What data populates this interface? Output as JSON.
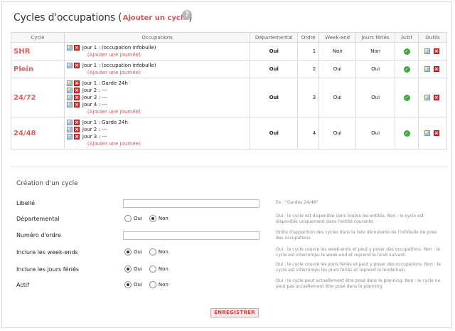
{
  "header": {
    "title": "Cycles d'occupations",
    "open_paren": "(",
    "add_link": "Ajouter un cycle",
    "close_paren": ")",
    "help_icon": "question-circle-icon"
  },
  "table": {
    "columns": [
      "Cycle",
      "Occupations",
      "Départemental",
      "Ordre",
      "Week-end",
      "Jours fériés",
      "Actif",
      "Outils"
    ],
    "add_day_link": "Ajouter une journée",
    "add_day_open": "(",
    "add_day_close": ")",
    "rows": [
      {
        "name": "SHR",
        "occupations": [
          "Jour 1 : (occupation infobulle)"
        ],
        "departemental": "Oui",
        "ordre": "1",
        "weekend": "Non",
        "feries": "Non",
        "actif": "check-icon"
      },
      {
        "name": "Plein",
        "occupations": [
          "Jour 1 : (occupation infobulle)"
        ],
        "departemental": "Oui",
        "ordre": "2",
        "weekend": "Oui",
        "feries": "Oui",
        "actif": "check-icon"
      },
      {
        "name": "24/72",
        "occupations": [
          "Jour 1 : Garde 24h",
          "Jour 2 : ---",
          "Jour 3 : ---",
          "Jour 4 : ---"
        ],
        "departemental": "Oui",
        "ordre": "3",
        "weekend": "Oui",
        "feries": "Oui",
        "actif": "check-icon"
      },
      {
        "name": "24/48",
        "occupations": [
          "Jour 1 : Garde 24h",
          "Jour 2 : ---",
          "Jour 3 : ---"
        ],
        "departemental": "Oui",
        "ordre": "4",
        "weekend": "Oui",
        "feries": "Oui",
        "actif": "check-icon"
      }
    ]
  },
  "form": {
    "title": "Création d'un cycle",
    "libelle": {
      "label": "Libellé",
      "value": "",
      "help": "Ex : \"Gardes 24/48\""
    },
    "departemental": {
      "label": "Départemental",
      "options": [
        "Oui",
        "Non"
      ],
      "selected": "Non",
      "help": "Oui : le cycle est disponible dans toutes les entités.\nNon : le cycle est disponible uniquement dans l'entité courante."
    },
    "ordre": {
      "label": "Numéro d'ordre",
      "value": "",
      "help": "Ordre d'apparition des cycles dans la liste déroulante de l'infobulle de pose des occupations"
    },
    "weekends": {
      "label": "Inclure les week-ends",
      "options": [
        "Oui",
        "Non"
      ],
      "selected": "Oui",
      "help": "Oui : le cycle couvre les week-ends et peut y poser des occupations.\nNon : le cycle est interrompu le week-end et reprend le lundi suivant."
    },
    "feries": {
      "label": "Inclure les jours fériés",
      "options": [
        "Oui",
        "Non"
      ],
      "selected": "Oui",
      "help": "Oui : le cycle couvre les jours fériés et peut y poser des occupations.\nNon : le cycle est interrompu les jours fériés et reprend le lendemain."
    },
    "actif": {
      "label": "Actif",
      "options": [
        "Oui",
        "Non"
      ],
      "selected": "Oui",
      "help": "Oui : le cycle peut actuellement être posé dans le planning.\nNon : le cycle ne peut pas actuellement être posé dans le planning."
    },
    "submit": "ENREGISTRER"
  },
  "colors": {
    "accent": "#e05050",
    "check": "#3fa93f",
    "delete": "#d93030"
  }
}
